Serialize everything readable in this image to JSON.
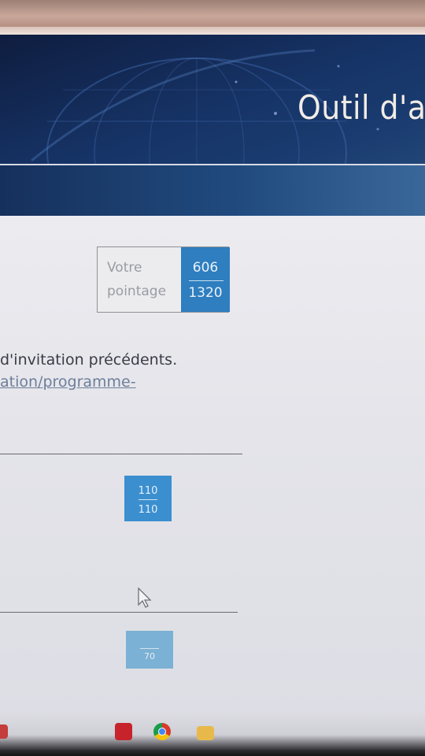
{
  "banner": {
    "title": "Outil d'a"
  },
  "score": {
    "label_line1": "Votre",
    "label_line2": "pointage",
    "numerator": "606",
    "denominator": "1320"
  },
  "description": {
    "text": "d'invitation précédents.",
    "link": "ation/programme-"
  },
  "items": [
    {
      "numerator": "110",
      "denominator": "110"
    },
    {
      "numerator": "",
      "denominator": "70"
    }
  ],
  "taskbar": {
    "icons": [
      "pdf-reader-icon",
      "chrome-icon",
      "file-explorer-icon"
    ]
  },
  "colors": {
    "banner": "#163366",
    "score_badge": "#2e7ec0",
    "item_badge": "#3b8fcf"
  }
}
